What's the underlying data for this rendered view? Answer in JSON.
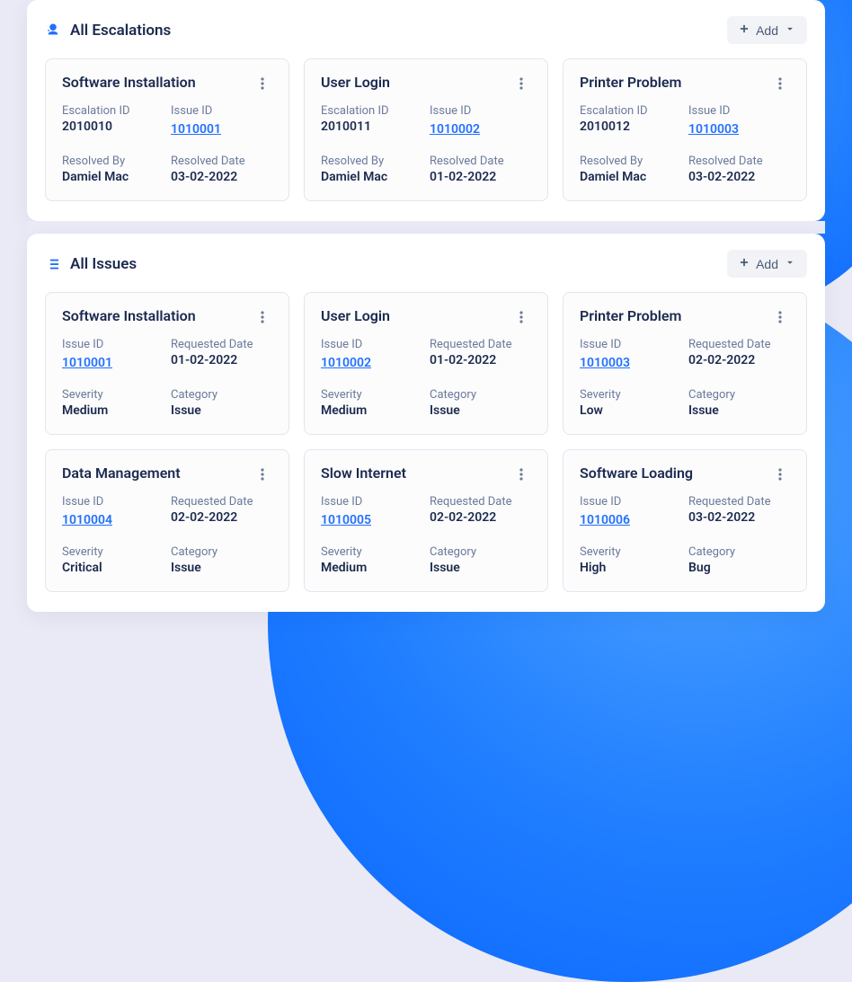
{
  "escalations_section": {
    "title": "All Escalations",
    "add_label": "Add",
    "labels": {
      "escalation_id": "Escalation ID",
      "issue_id": "Issue ID",
      "resolved_by": "Resolved By",
      "resolved_date": "Resolved Date"
    },
    "cards": [
      {
        "title": "Software Installation",
        "escalation_id": "2010010",
        "issue_id": "1010001",
        "resolved_by": "Damiel Mac",
        "resolved_date": "03-02-2022"
      },
      {
        "title": "User Login",
        "escalation_id": "2010011",
        "issue_id": "1010002",
        "resolved_by": "Damiel Mac",
        "resolved_date": "01-02-2022"
      },
      {
        "title": "Printer Problem",
        "escalation_id": "2010012",
        "issue_id": "1010003",
        "resolved_by": "Damiel Mac",
        "resolved_date": "03-02-2022"
      }
    ]
  },
  "issues_section": {
    "title": "All Issues",
    "add_label": "Add",
    "labels": {
      "issue_id": "Issue ID",
      "requested_date": "Requested Date",
      "severity": "Severity",
      "category": "Category"
    },
    "cards": [
      {
        "title": "Software Installation",
        "issue_id": "1010001",
        "requested_date": "01-02-2022",
        "severity": "Medium",
        "category": "Issue"
      },
      {
        "title": "User Login",
        "issue_id": "1010002",
        "requested_date": "01-02-2022",
        "severity": "Medium",
        "category": "Issue"
      },
      {
        "title": "Printer Problem",
        "issue_id": "1010003",
        "requested_date": "02-02-2022",
        "severity": "Low",
        "category": "Issue"
      },
      {
        "title": "Data Management",
        "issue_id": "1010004",
        "requested_date": "02-02-2022",
        "severity": "Critical",
        "category": "Issue"
      },
      {
        "title": "Slow Internet",
        "issue_id": "1010005",
        "requested_date": "02-02-2022",
        "severity": "Medium",
        "category": "Issue"
      },
      {
        "title": "Software Loading",
        "issue_id": "1010006",
        "requested_date": "03-02-2022",
        "severity": "High",
        "category": "Bug"
      }
    ]
  }
}
